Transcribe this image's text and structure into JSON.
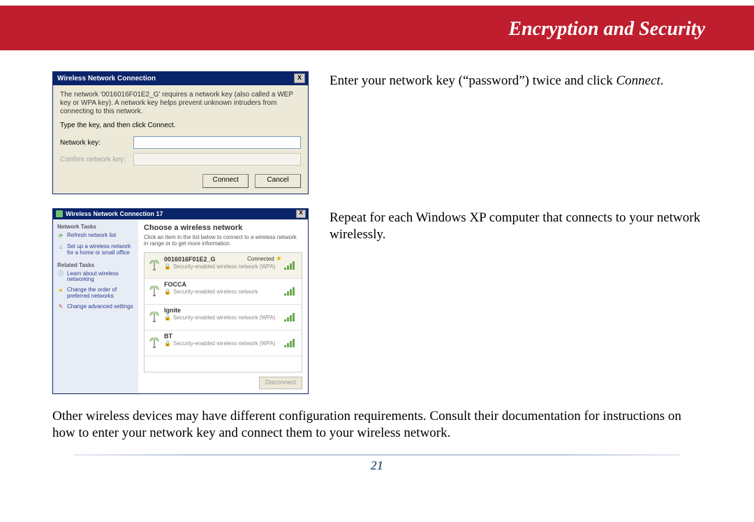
{
  "header": {
    "title": "Encryption and Security"
  },
  "instruction1": {
    "line1": "Enter your network key (“password”) twice and click",
    "emph": "Connect",
    "tail": "."
  },
  "instruction2": "Repeat for each Windows XP computer that connects to your network wirelessly.",
  "bottom_text": "Other wireless devices may have different configuration requirements.  Consult their documentation for instructions on how to enter your network key and connect them to your wireless network.",
  "page_number": "21",
  "dialog1": {
    "title": "Wireless Network Connection",
    "close": "X",
    "message": "The network '0016016F01E2_G' requires a network key (also called a WEP key or WPA key). A network key helps prevent unknown intruders from connecting to this network.",
    "instruction": "Type the key, and then click Connect.",
    "label_key": "Network key:",
    "label_confirm": "Confirm network key:",
    "btn_connect": "Connect",
    "btn_cancel": "Cancel"
  },
  "dialog2": {
    "title": "Wireless Network Connection 17",
    "close": "X",
    "side": {
      "section1": "Network Tasks",
      "link_refresh": "Refresh network list",
      "link_setup": "Set up a wireless network for a home or small office",
      "section2": "Related Tasks",
      "link_learn": "Learn about wireless networking",
      "link_order": "Change the order of preferred networks",
      "link_adv": "Change advanced settings"
    },
    "main": {
      "heading": "Choose a wireless network",
      "sub": "Click an item in the list below to connect to a wireless network in range or to get more information.",
      "btn_disconnect": "Disconnect"
    },
    "networks": [
      {
        "name": "0016016F01E2_G",
        "status": "Connected",
        "security": "Security-enabled wireless network (WPA)",
        "starred": true,
        "selected": true
      },
      {
        "name": "FOCCA",
        "status": "",
        "security": "Security-enabled wireless network",
        "starred": false,
        "selected": false
      },
      {
        "name": "Ignite",
        "status": "",
        "security": "Security-enabled wireless network (WPA)",
        "starred": false,
        "selected": false
      },
      {
        "name": "BT",
        "status": "",
        "security": "Security-enabled wireless network (WPA)",
        "starred": false,
        "selected": false
      }
    ]
  }
}
